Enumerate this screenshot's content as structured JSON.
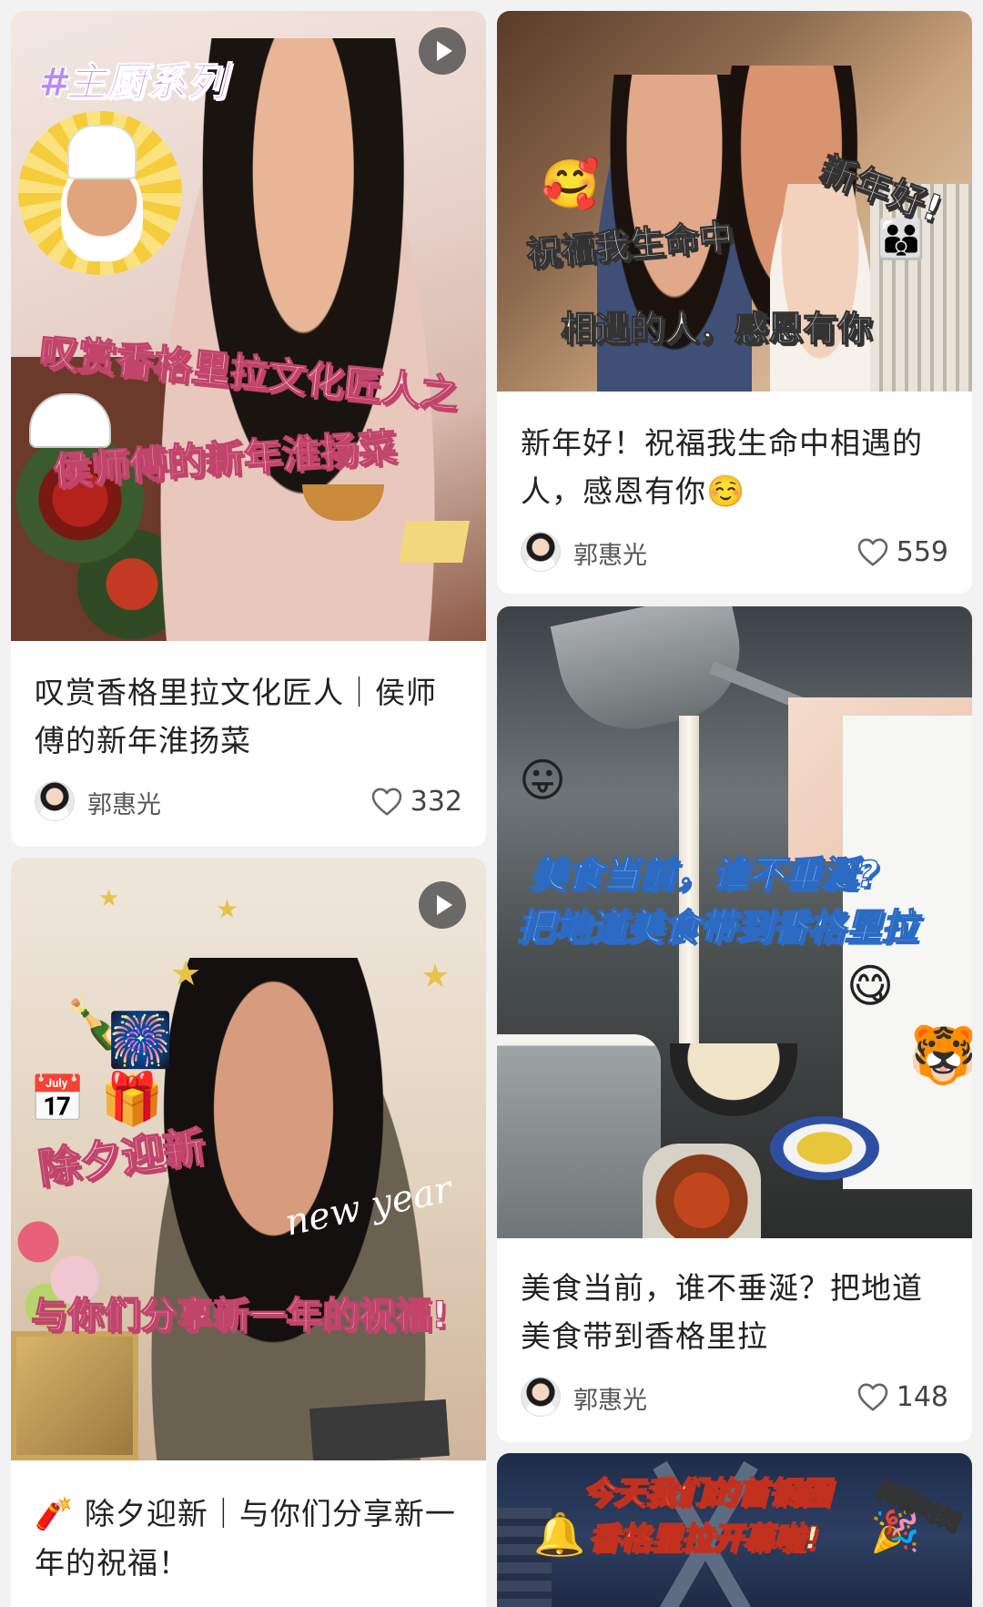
{
  "posts": [
    {
      "title": "叹赏香格里拉文化匠人｜侯师傅的新年淮扬菜",
      "author": "郭惠光",
      "likes": "332",
      "cover": {
        "tag": "#主厨系列",
        "line1": "叹赏香格里拉文化匠人之",
        "line2": "侯师傅的新年淮扬菜"
      }
    },
    {
      "title": "新年好！祝福我生命中相遇的人，感恩有你",
      "title_emoji": "☺️",
      "author": "郭惠光",
      "likes": "559",
      "cover": {
        "corner": "新年好!",
        "line1": "祝福我生命中",
        "line2": "相遇的人，感恩有你"
      }
    },
    {
      "title": "美食当前，谁不垂涎？把地道美食带到香格里拉",
      "author": "郭惠光",
      "likes": "148",
      "cover": {
        "line1": "美食当前，谁不垂涎?",
        "line2": "把地道美食带到香格里拉"
      }
    },
    {
      "title": "除夕迎新｜与你们分享新一年的祝福！",
      "title_emoji": "🧨",
      "cover": {
        "line1": "除夕迎新",
        "script": "new year",
        "line2": "与你们分享新一年的祝福!"
      }
    },
    {
      "cover": {
        "line1": "今天我们的首钢园",
        "line2": "香格里拉开幕啦!",
        "corner": "揭幕时刻"
      }
    }
  ],
  "icons": {
    "play": "play-icon",
    "like": "heart-outline-icon"
  }
}
